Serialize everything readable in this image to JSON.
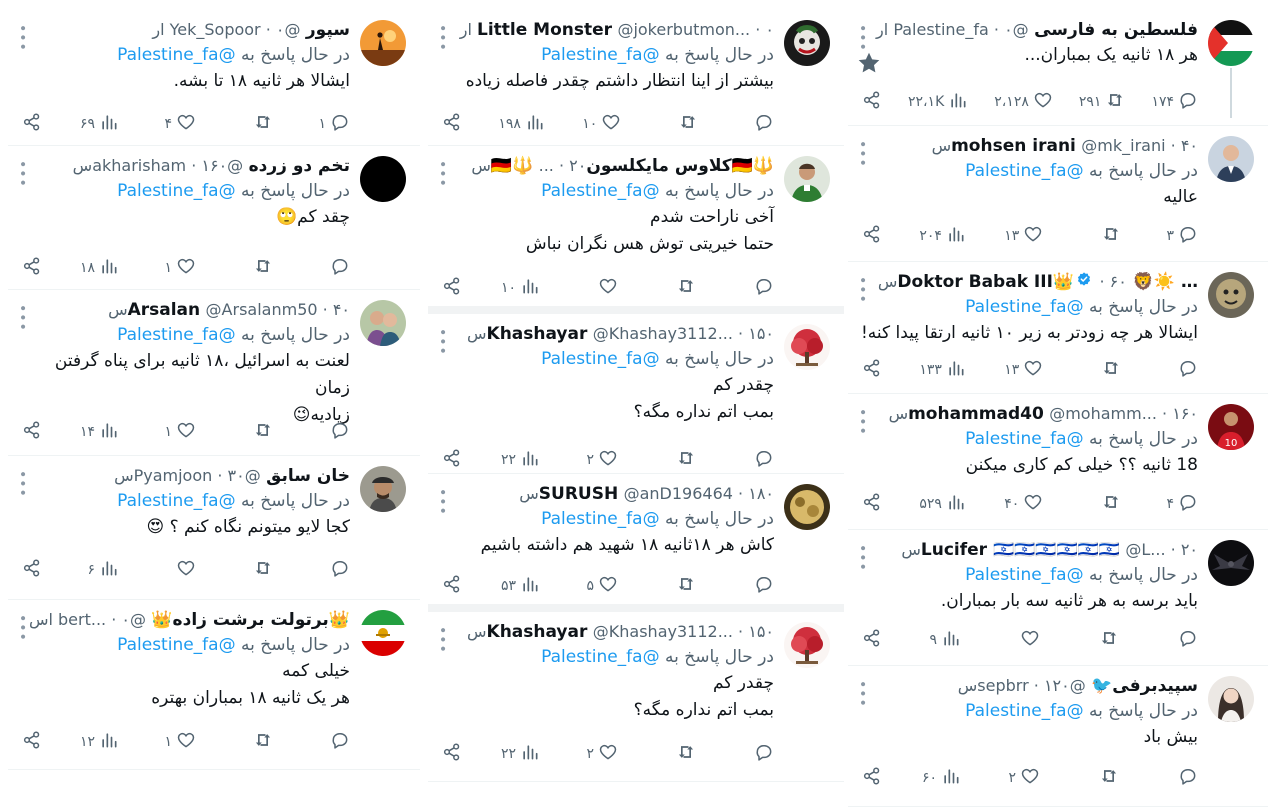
{
  "columns": [
    {
      "tweets": [
        {
          "avatar": "palestine-flag",
          "name": "فلسطین به فارسی",
          "handle": "@Palestine_fa",
          "time": "۰ ار",
          "reply_prefix": "",
          "mention": "",
          "lines": [
            "هر ۱۸ ثانیه یک بمباران..."
          ],
          "counts": {
            "reply": "۱۷۴",
            "retweet": "۲۹۱",
            "like": "۲،۱۲۸",
            "views": "۲۲،۱K"
          },
          "badge": ""
        },
        {
          "avatar": "man-suit",
          "name": "mohsen irani",
          "handle": "@mk_irani",
          "time": "۴۰س",
          "reply_prefix": "در حال پاسخ به",
          "mention": "@Palestine_fa",
          "lines": [
            "عالیه"
          ],
          "counts": {
            "reply": "۳",
            "retweet": "",
            "like": "۱۳",
            "views": "۲۰۴"
          },
          "badge": ""
        },
        {
          "avatar": "lion-art",
          "name": "… ☀️🦁 Doktor Babak III👑",
          "handle": "",
          "time": "۶۰س",
          "reply_prefix": "در حال پاسخ به",
          "mention": "@Palestine_fa",
          "lines": [
            "ایشالا هر چه زودتر به زیر ۱۰ ثانیه ارتقا پیدا کنه!"
          ],
          "counts": {
            "reply": "",
            "retweet": "",
            "like": "۱۳",
            "views": "۱۳۳"
          },
          "badge": "verified"
        },
        {
          "avatar": "football-red",
          "name": "mohammad40",
          "handle": "@mohamm...",
          "time": "۱۶۰س",
          "reply_prefix": "در حال پاسخ به",
          "mention": "@Palestine_fa",
          "lines": [
            "18 ثانیه ؟؟ خیلی  کم کاری میکنن"
          ],
          "counts": {
            "reply": "۴",
            "retweet": "",
            "like": "۴۰",
            "views": "۵۲۹"
          },
          "badge": ""
        },
        {
          "avatar": "dark-wings",
          "name": "Lucifer 🇮🇱🇮🇱🇮🇱🇮🇱🇮🇱🇮🇱",
          "handle": "@L...",
          "time": "۲۰س",
          "reply_prefix": "در حال پاسخ به",
          "mention": "@Palestine_fa",
          "lines": [
            "باید برسه به هر ثانیه سه بار بمباران."
          ],
          "counts": {
            "reply": "",
            "retweet": "",
            "like": "",
            "views": "۹"
          },
          "badge": ""
        },
        {
          "avatar": "woman",
          "name": "سپیدبرفی🐦",
          "handle": "@sepbrr",
          "time": "۱۲۰س",
          "reply_prefix": "در حال پاسخ به",
          "mention": "@Palestine_fa",
          "lines": [
            "بیش باد"
          ],
          "counts": {
            "reply": "",
            "retweet": "",
            "like": "۲",
            "views": "۶۰"
          },
          "badge": ""
        }
      ]
    },
    {
      "tweets": [
        {
          "avatar": "joker",
          "name": "Little Monster",
          "handle": "@jokerbutmon...",
          "time": "۰ ار",
          "reply_prefix": "در حال پاسخ به",
          "mention": "@Palestine_fa",
          "lines": [
            "بیشتر از اینا انتظار داشتم چقدر فاصله زیاده"
          ],
          "counts": {
            "reply": "",
            "retweet": "",
            "like": "۱۰",
            "views": "۱۹۸"
          },
          "badge": ""
        },
        {
          "avatar": "green-shirt",
          "name": "🔱🇩🇪کلاوس مایکلسون🇩🇪🔱",
          "handle": "...",
          "time": "۲۰س",
          "reply_prefix": "در حال پاسخ به",
          "mention": "@Palestine_fa",
          "lines": [
            "آخی ناراحت شدم",
            "حتما خیریتی توش هس نگران نباش"
          ],
          "counts": {
            "reply": "",
            "retweet": "",
            "like": "",
            "views": "۱۰"
          },
          "badge": ""
        },
        {
          "avatar": "red-tree",
          "name": "Khashayar",
          "handle": "@Khashay3112...",
          "time": "۱۵۰س",
          "reply_prefix": "در حال پاسخ به",
          "mention": "@Palestine_fa",
          "lines": [
            "چقدر کم",
            "بمب اتم نداره مگه؟"
          ],
          "counts": {
            "reply": "",
            "retweet": "",
            "like": "۲",
            "views": "۲۲"
          },
          "badge": ""
        },
        {
          "avatar": "gold-blob",
          "name": "SURUSH",
          "handle": "@anD196464",
          "time": "۱۸۰س",
          "reply_prefix": "در حال پاسخ به",
          "mention": "@Palestine_fa",
          "lines": [
            "کاش هر ۱۸ثانیه ۱۸ شهید هم داشته باشیم"
          ],
          "counts": {
            "reply": "",
            "retweet": "",
            "like": "۵",
            "views": "۵۳"
          },
          "badge": ""
        },
        {
          "avatar": "red-tree",
          "name": "Khashayar",
          "handle": "@Khashay3112...",
          "time": "۱۵۰س",
          "reply_prefix": "در حال پاسخ به",
          "mention": "@Palestine_fa",
          "lines": [
            "چقدر کم",
            "بمب اتم نداره مگه؟"
          ],
          "counts": {
            "reply": "",
            "retweet": "",
            "like": "۲",
            "views": "۲۲"
          },
          "badge": ""
        }
      ]
    },
    {
      "tweets": [
        {
          "avatar": "sunset-figure",
          "name": "سپور",
          "handle": "@Yek_Sopoor",
          "time": "۰ ار",
          "reply_prefix": "در حال پاسخ به",
          "mention": "@Palestine_fa",
          "lines": [
            "ایشالا هر ثانیه ۱۸ تا بشه."
          ],
          "counts": {
            "reply": "۱",
            "retweet": "",
            "like": "۴",
            "views": "۶۹"
          },
          "badge": ""
        },
        {
          "avatar": "black",
          "name": "تخم دو زرده",
          "handle": "@akharisham",
          "time": "۱۶۰س",
          "reply_prefix": "در حال پاسخ به",
          "mention": "@Palestine_fa",
          "lines": [
            "چقد کم🙄"
          ],
          "counts": {
            "reply": "",
            "retweet": "",
            "like": "۱",
            "views": "۱۸"
          },
          "badge": ""
        },
        {
          "avatar": "couple",
          "name": "Arsalan",
          "handle": "@Arsalanm50",
          "time": "۴۰س",
          "reply_prefix": "در حال پاسخ به",
          "mention": "@Palestine_fa",
          "lines": [
            "لعنت به اسرائیل ،۱۸ ثانیه برای پناه گرفتن زمان",
            "زیادیه😉"
          ],
          "counts": {
            "reply": "",
            "retweet": "",
            "like": "۱",
            "views": "۱۴"
          },
          "badge": ""
        },
        {
          "avatar": "man-cap",
          "name": "خان سابق",
          "handle": "@Pyamjoon",
          "time": "۳۰س",
          "reply_prefix": "در حال پاسخ به",
          "mention": "@Palestine_fa",
          "lines": [
            "کجا لایو میتونم نگاه کنم ؟ 😍"
          ],
          "counts": {
            "reply": "",
            "retweet": "",
            "like": "",
            "views": "۶"
          },
          "badge": ""
        },
        {
          "avatar": "lion-flag",
          "name": "👑برتولت برشت زاده👑",
          "handle": "@bert...",
          "time": "۰ اس",
          "reply_prefix": "در حال پاسخ به",
          "mention": "@Palestine_fa",
          "lines": [
            "خیلی کمه",
            "هر یک ثانیه ۱۸ بمباران  بهتره"
          ],
          "counts": {
            "reply": "",
            "retweet": "",
            "like": "۱",
            "views": "۱۲"
          },
          "badge": ""
        }
      ]
    }
  ]
}
